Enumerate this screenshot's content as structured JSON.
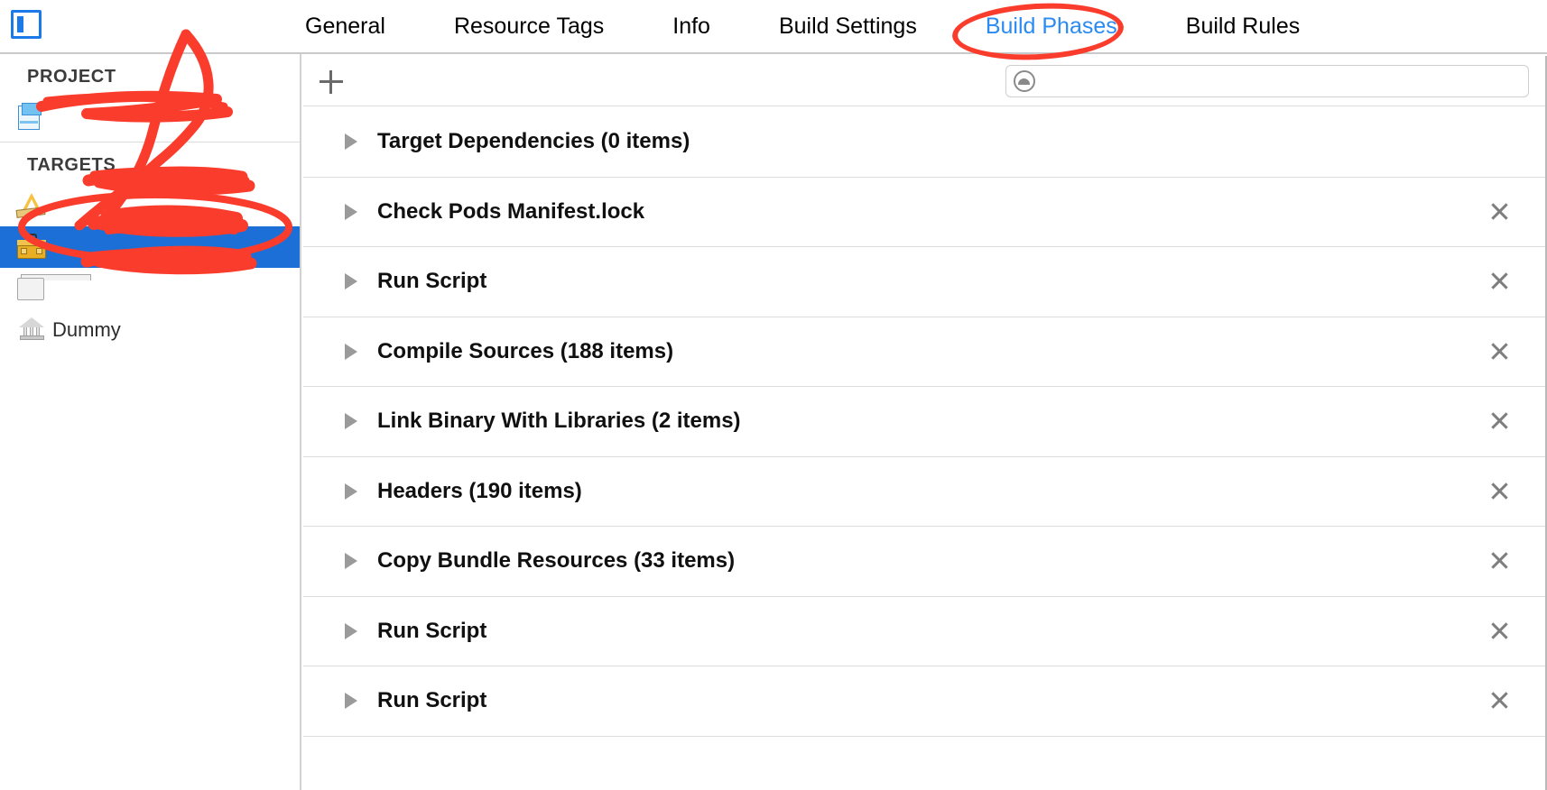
{
  "window": {
    "nav_toggle_icon": "sidebar-toggle-icon",
    "accent_blue": "#2a8bf2",
    "selection_blue": "#1c6fd6",
    "annotation_red": "#fa3c2c"
  },
  "tabs": [
    {
      "label": "General",
      "selected": false
    },
    {
      "label": "Resource Tags",
      "selected": false
    },
    {
      "label": "Info",
      "selected": false
    },
    {
      "label": "Build Settings",
      "selected": false
    },
    {
      "label": "Build Phases",
      "selected": true
    },
    {
      "label": "Build Rules",
      "selected": false
    }
  ],
  "sidebar": {
    "project_header": "PROJECT",
    "targets_header": "TARGETS",
    "project_items": [
      {
        "label": "",
        "icon": "project-icon",
        "redacted": true,
        "selected": false
      }
    ],
    "target_items": [
      {
        "label": "",
        "icon": "app-target-icon",
        "redacted": true,
        "selected": false
      },
      {
        "label": "",
        "icon": "toolbox-target-icon",
        "redacted": true,
        "selected": true
      },
      {
        "label": "",
        "icon": "test-bundle-icon",
        "redacted": true,
        "selected": false
      },
      {
        "label": "Dummy",
        "icon": "framework-icon",
        "redacted": false,
        "selected": false
      }
    ]
  },
  "toolbar": {
    "add_label": "+",
    "add_icon": "plus-icon",
    "search_icon": "search-icon",
    "search_value": "",
    "search_placeholder": ""
  },
  "build_phases": [
    {
      "title": "Target Dependencies (0 items)",
      "expanded": false,
      "deletable": false
    },
    {
      "title": "Check Pods Manifest.lock",
      "expanded": false,
      "deletable": true
    },
    {
      "title": "Run Script",
      "expanded": false,
      "deletable": true
    },
    {
      "title": "Compile Sources (188 items)",
      "expanded": false,
      "deletable": true
    },
    {
      "title": "Link Binary With Libraries (2 items)",
      "expanded": false,
      "deletable": true
    },
    {
      "title": "Headers (190 items)",
      "expanded": false,
      "deletable": true
    },
    {
      "title": "Copy Bundle Resources (33 items)",
      "expanded": false,
      "deletable": true
    },
    {
      "title": "Run Script",
      "expanded": false,
      "deletable": true
    },
    {
      "title": "Run Script",
      "expanded": false,
      "deletable": true
    }
  ],
  "annotations": {
    "tab_circle": "red-ellipse-around-build-phases-tab",
    "target_circle": "red-ellipse-around-selected-target",
    "redaction_scribbles": "red-marker-strikethrough-over-names",
    "arrow": "red-curved-arrow-from-tab-to-target"
  }
}
